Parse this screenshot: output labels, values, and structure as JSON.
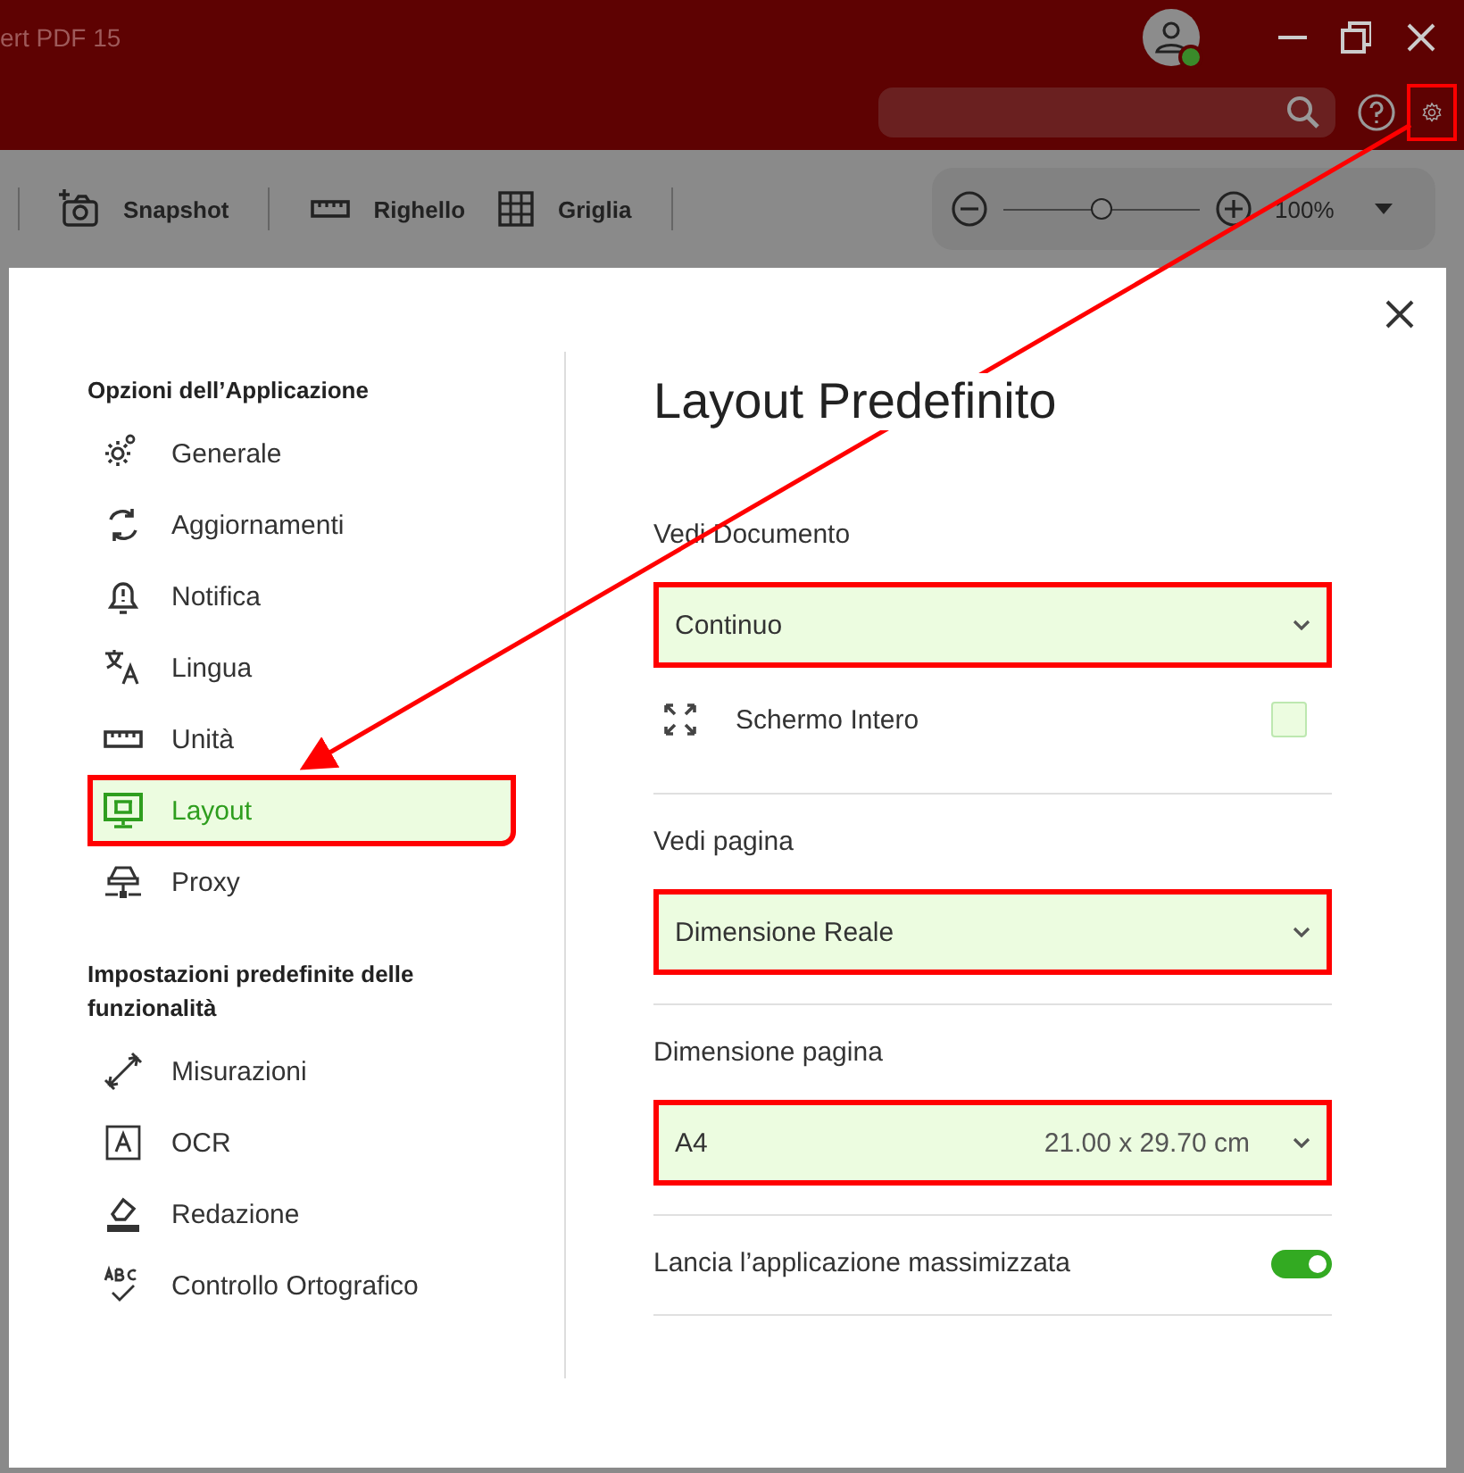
{
  "window": {
    "title": "ert PDF 15",
    "account": {
      "online": true
    },
    "settings_highlighted": true
  },
  "toolbar": {
    "tools": [
      {
        "kind": "snapshot",
        "label": "Snapshot"
      },
      {
        "kind": "ruler",
        "label": "Righello"
      },
      {
        "kind": "grid",
        "label": "Griglia"
      }
    ],
    "zoom": {
      "level": 0.5,
      "reading": "100%"
    }
  },
  "dialog": {
    "sidebar": {
      "groups": [
        {
          "heading": "Opzioni dell’Applicazione",
          "items": [
            {
              "kind": "gear",
              "label": "Generale",
              "selected": false,
              "highlighted": false
            },
            {
              "kind": "sync",
              "label": "Aggiornamenti",
              "selected": false,
              "highlighted": false
            },
            {
              "kind": "bell",
              "label": "Notifica",
              "selected": false,
              "highlighted": false
            },
            {
              "kind": "lang",
              "label": "Lingua",
              "selected": false,
              "highlighted": false
            },
            {
              "kind": "ruler",
              "label": "Unità",
              "selected": false,
              "highlighted": false
            },
            {
              "kind": "layout",
              "label": "Layout",
              "selected": true,
              "highlighted": true
            },
            {
              "kind": "proxy",
              "label": "Proxy",
              "selected": false,
              "highlighted": false
            }
          ]
        },
        {
          "heading": "Impostazioni predefinite delle funzionalità",
          "items": [
            {
              "kind": "measure",
              "label": "Misurazioni",
              "selected": false,
              "highlighted": false
            },
            {
              "kind": "ocr",
              "label": "OCR",
              "selected": false,
              "highlighted": false
            },
            {
              "kind": "eraser",
              "label": "Redazione",
              "selected": false,
              "highlighted": false
            },
            {
              "kind": "spell",
              "label": "Controllo Ortografico",
              "selected": false,
              "highlighted": false
            }
          ]
        }
      ]
    },
    "title": "Layout Predefinito",
    "sections": [
      {
        "label": "Vedi Documento",
        "select": {
          "value": "Continuo",
          "highlighted": true
        },
        "option": {
          "label": "Schermo Intero",
          "checked": false
        }
      },
      {
        "label": "Vedi pagina",
        "select": {
          "value": "Dimensione Reale",
          "highlighted": true
        }
      },
      {
        "label": "Dimensione pagina",
        "select": {
          "value": "A4",
          "detail": "21.00 x 29.70 cm",
          "highlighted": true
        }
      }
    ],
    "toggle": {
      "label": "Lancia l’applicazione massimizzata",
      "on": true
    }
  }
}
